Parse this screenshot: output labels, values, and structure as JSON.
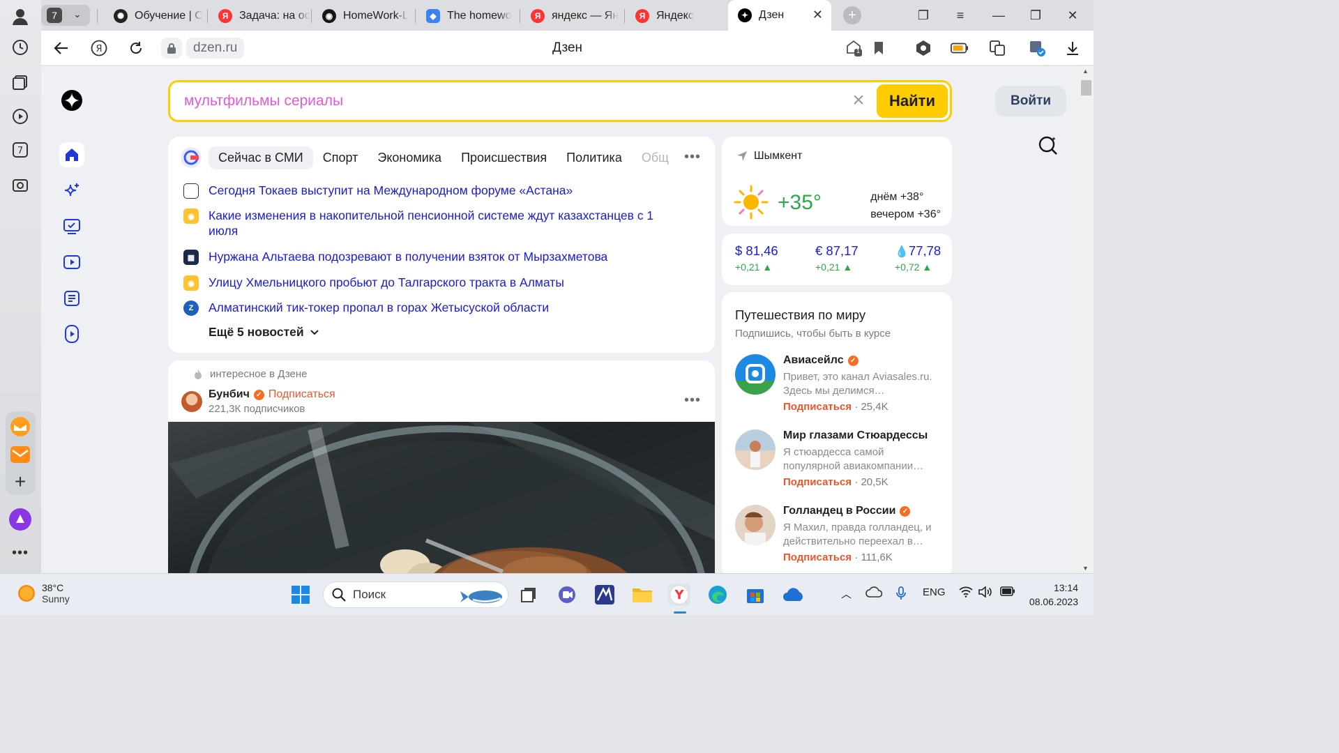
{
  "tabs": {
    "counter": "7",
    "items": [
      {
        "title": "Обучение | C"
      },
      {
        "title": "Задача: на ос"
      },
      {
        "title": "HomeWork-L"
      },
      {
        "title": "The homewo"
      },
      {
        "title": "яндекс — Ян"
      },
      {
        "title": "Яндекс"
      },
      {
        "title": "Дзен",
        "active": true
      }
    ]
  },
  "address_bar": {
    "url": "dzen.ru",
    "page_title": "Дзен",
    "tabs_badge": "1"
  },
  "search": {
    "query": "мультфильмы сериалы",
    "button_label": "Найти"
  },
  "login_label": "Войти",
  "news": {
    "tabs": [
      "Сейчас в СМИ",
      "Спорт",
      "Экономика",
      "Происшествия",
      "Политика",
      "Общ"
    ],
    "items": [
      {
        "text": "Сегодня Токаев выступит на Международном форуме «Астана»"
      },
      {
        "text": "Какие изменения в накопительной пенсионной системе ждут казахстанцев с 1 июля"
      },
      {
        "text": "Нуржана Альтаева подозревают в получении взяток от Мырзахметова"
      },
      {
        "text": "Улицу Хмельницкого пробьют до Талгарского тракта в Алматы"
      },
      {
        "text": "Алматинский тик-токер пропал в горах Жетысуской области"
      }
    ],
    "more_label": "Ещё 5 новостей"
  },
  "post": {
    "hint": "интересное в Дзене",
    "author": "Бунбич",
    "subscribe": "Подписаться",
    "subscribers": "221,3К подписчиков"
  },
  "weather": {
    "city": "Шымкент",
    "temp": "+35°",
    "day": "днём +38°",
    "evening": "вечером +36°"
  },
  "rates": [
    {
      "value": "$ 81,46",
      "delta": "+0,21"
    },
    {
      "value": "€ 87,17",
      "delta": "+0,21"
    },
    {
      "value": "77,78",
      "delta": "+0,72"
    }
  ],
  "channels": {
    "title": "Путешествия по миру",
    "hint": "Подпишись, чтобы быть в курсе",
    "items": [
      {
        "name": "Авиасейлс",
        "desc": "Привет, это канал Aviasales.ru. Здесь мы делимся…",
        "subscribe": "Подписаться",
        "count": "25,4K"
      },
      {
        "name": "Мир глазами Стюардессы",
        "desc": "Я стюардесса самой популярной авиакомпании…",
        "subscribe": "Подписаться",
        "count": "20,5K"
      },
      {
        "name": "Голландец в России",
        "desc": "Я Махил, правда голландец, и действительно переехал в…",
        "subscribe": "Подписаться",
        "count": "111,6K"
      }
    ]
  },
  "taskbar": {
    "weather_temp": "38°C",
    "weather_text": "Sunny",
    "search_placeholder": "Поиск",
    "lang": "ENG",
    "time": "13:14",
    "date": "08.06.2023"
  },
  "colors": {
    "accent_yellow": "#ffcc00",
    "link_blue": "#1a1adb",
    "subscribe_orange": "#e8572a",
    "positive_green": "#2ca84a"
  }
}
